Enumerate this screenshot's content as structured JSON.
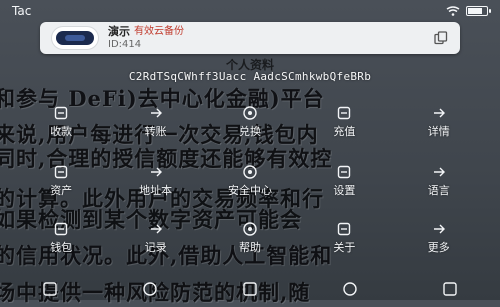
{
  "status_bar": {
    "carrier": "Tac",
    "battery_level": 0.85
  },
  "account": {
    "name": "演示",
    "tag": "有效云备份",
    "id": "ID:414"
  },
  "section_title": "个人资料",
  "wallet_address": "C2RdTSqCWhff3Uacc AadcSCmhkwbQfeBRb",
  "background_text": {
    "line1": "和参与 DeFi)去中心化金融)平台",
    "line2": "来说,用户每进行一次交易,钱包内",
    "line3": "同时,合理的授信额度还能够有效控",
    "line4": "的计算。此外用户的交易频率和行",
    "line5": "如果检测到某个数字资产可能会",
    "line6": "的信用状况。此外,借助人工智能和",
    "line7": "场中提供一种风险防范的机制,随"
  },
  "actions_row1": [
    {
      "label": "收款",
      "icon": "receive-icon"
    },
    {
      "label": "转账",
      "icon": "transfer-icon"
    },
    {
      "label": "兑换",
      "icon": "swap-icon"
    },
    {
      "label": "充值",
      "icon": "topup-icon"
    },
    {
      "label": "详情",
      "icon": "detail-icon"
    }
  ],
  "actions_row2": [
    {
      "label": "资产",
      "icon": "asset-icon"
    },
    {
      "label": "地址本",
      "icon": "address-book-icon"
    },
    {
      "label": "安全中心",
      "icon": "shield-icon"
    },
    {
      "label": "设置",
      "icon": "gear-icon"
    },
    {
      "label": "语言",
      "icon": "globe-icon"
    }
  ],
  "actions_row3": [
    {
      "label": "钱包",
      "icon": "wallet-icon"
    },
    {
      "label": "记录",
      "icon": "record-icon"
    },
    {
      "label": "帮助",
      "icon": "help-icon"
    },
    {
      "label": "关于",
      "icon": "info-icon"
    },
    {
      "label": "更多",
      "icon": "more-icon"
    }
  ],
  "bottom_nav": [
    "home-icon",
    "market-icon",
    "discover-icon",
    "browser-icon",
    "profile-icon"
  ]
}
